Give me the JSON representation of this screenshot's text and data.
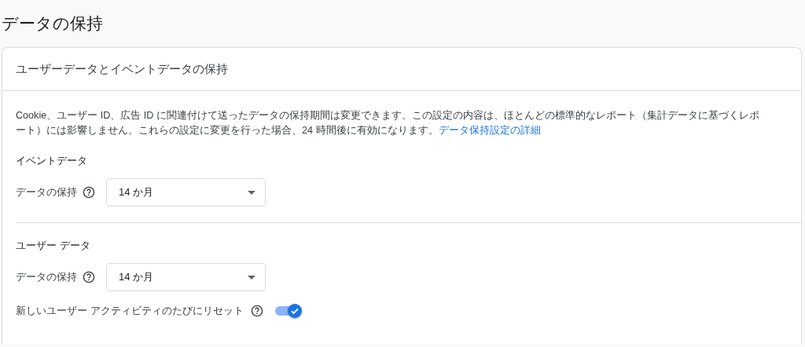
{
  "page_title": "データの保持",
  "card": {
    "title": "ユーザーデータとイベントデータの保持",
    "description_lines": [
      "Cookie、ユーザー ID、広告 ID に関連付けて送ったデータの保持期間は変更できます。この設定の内容は、ほとんどの標準的なレポート（集計データに基づくレポ",
      "ート）には影響しません。これらの設定に変更を行った場合、24 時間後に有効になります。"
    ],
    "description_link": "データ保持設定の詳細",
    "sections": [
      {
        "heading": "イベントデータ",
        "rows": [
          {
            "kind": "select",
            "label": "データの保持",
            "value": "14 か月"
          }
        ]
      },
      {
        "heading": "ユーザー データ",
        "rows": [
          {
            "kind": "select",
            "label": "データの保持",
            "value": "14 か月"
          },
          {
            "kind": "toggle",
            "label": "新しいユーザー アクティビティのたびにリセット",
            "on": true
          }
        ]
      }
    ]
  }
}
